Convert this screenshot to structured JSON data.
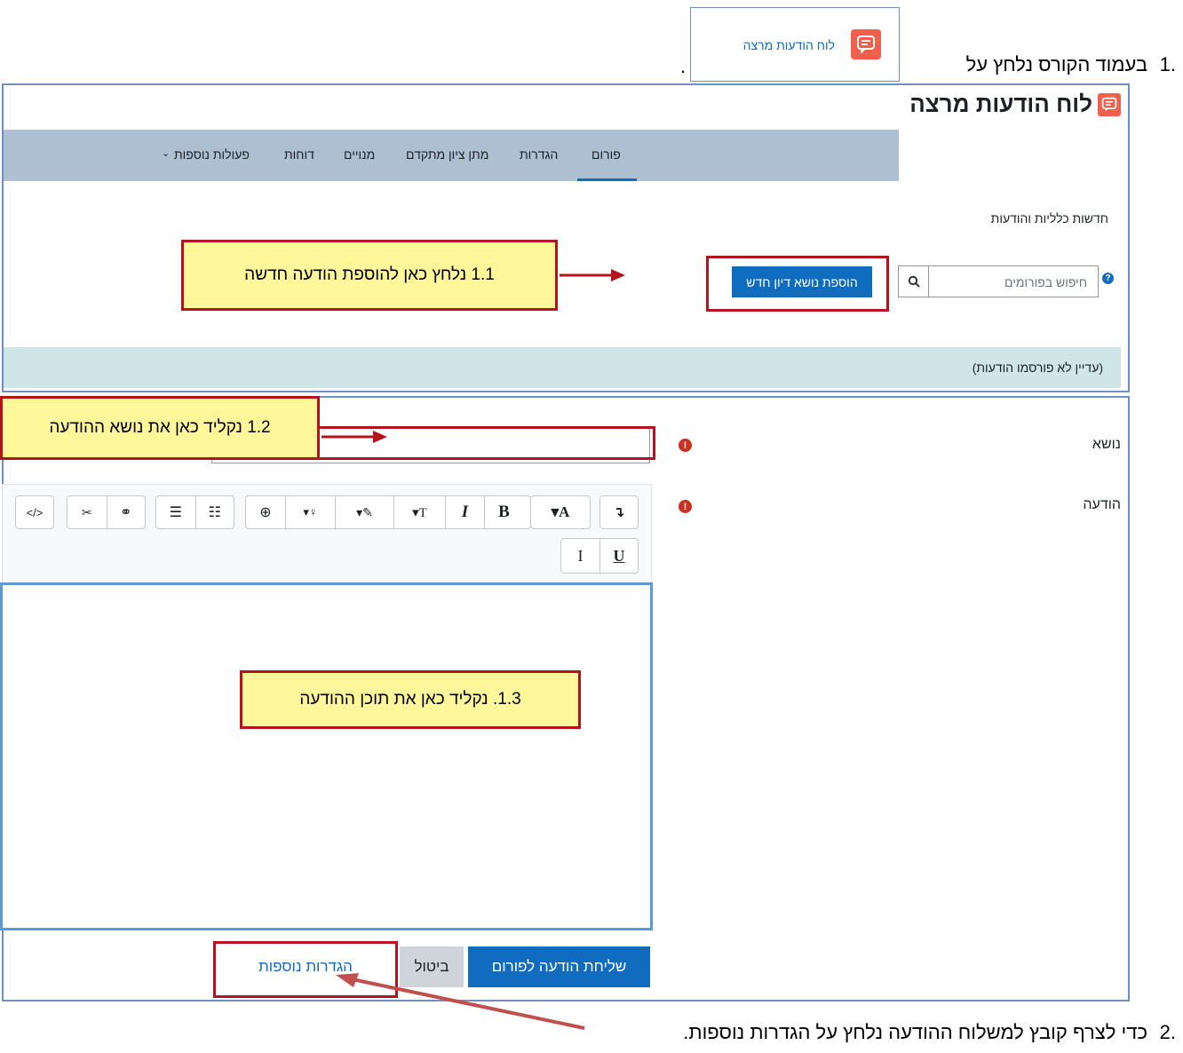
{
  "instructions": {
    "step1_number": "1.",
    "step1_text": "בעמוד הקורס נלחץ על",
    "step1_period": ".",
    "step2_number": "2.",
    "step2_text": "כדי לצרף קובץ למשלוח ההודעה נלחץ על הגדרות נוספות."
  },
  "link_preview": {
    "label": "לוח הודעות מרצה",
    "icon": "forum-chat-icon"
  },
  "forum": {
    "title": "לוח הודעות מרצה",
    "tabs": [
      "פורום",
      "הגדרות",
      "מתן ציון מתקדם",
      "מנויים",
      "דוחות",
      "פעולות נוספות"
    ],
    "active_tab": "פורום",
    "description": "חדשות כלליות והודעות",
    "search_placeholder": "חיפוש בפורומים",
    "add_button": "הוספת נושא דיון חדש",
    "empty_message": "(עדיין לא פורסמו הודעות)"
  },
  "post_form": {
    "subject_label": "נושא",
    "message_label": "הודעה",
    "subject_value": "",
    "submit_button": "שליחת הודעה לפורום",
    "cancel_button": "ביטול",
    "advanced_link": "הגדרות נוספות"
  },
  "callouts": {
    "c1": "1.1 נלחץ כאן להוספת הודעה חדשה",
    "c2": "1.2 נקליד כאן את נושא ההודעה",
    "c3": "1.3. נקליד כאן את תוכן ההודעה"
  },
  "toolbar": {
    "row1_icons": [
      "insert-icon",
      "font-color-icon",
      "bold-icon",
      "italic-icon",
      "font-size-icon",
      "highlight-icon",
      "accessibility-icon",
      "zoom-icon",
      "bullet-list-icon",
      "numbered-list-icon",
      "link-icon",
      "unlink-icon",
      "html-source-icon"
    ],
    "row2_icons": [
      "underline-icon",
      "clear-format-icon"
    ]
  },
  "colors": {
    "accent": "#0f6cbf",
    "navbar": "#aebfd2",
    "callout_fill": "#fff799",
    "callout_border": "#b5121b",
    "alert_bg": "#cfe5e8",
    "error": "#ca3120"
  }
}
